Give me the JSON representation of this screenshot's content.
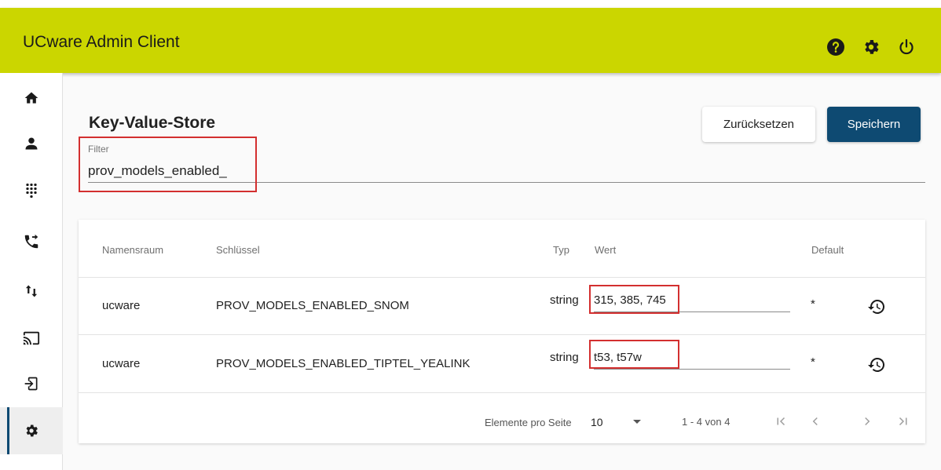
{
  "app": {
    "title": "UCware Admin Client"
  },
  "topbar": {
    "icons": [
      "help-icon",
      "gear-icon",
      "power-icon"
    ]
  },
  "sidebar": {
    "items": [
      {
        "icon": "home-icon"
      },
      {
        "icon": "person-icon"
      },
      {
        "icon": "dialpad-icon"
      },
      {
        "icon": "call-forward-icon"
      },
      {
        "icon": "sort-arrows-icon"
      },
      {
        "icon": "cast-icon"
      },
      {
        "icon": "login-icon"
      },
      {
        "icon": "gear-icon",
        "active": true
      }
    ]
  },
  "page": {
    "title": "Key-Value-Store",
    "reset_label": "Zurücksetzen",
    "save_label": "Speichern"
  },
  "filter": {
    "label": "Filter",
    "value": "prov_models_enabled_"
  },
  "table": {
    "columns": {
      "namespace": "Namensraum",
      "key": "Schlüssel",
      "type": "Typ",
      "value": "Wert",
      "default": "Default"
    },
    "rows": [
      {
        "namespace": "ucware",
        "key": "PROV_MODELS_ENABLED_SNOM",
        "type": "string",
        "value": "315, 385, 745",
        "default": "*"
      },
      {
        "namespace": "ucware",
        "key": "PROV_MODELS_ENABLED_TIPTEL_YEALINK",
        "type": "string",
        "value": "t53, t57w",
        "default": "*"
      }
    ]
  },
  "paginator": {
    "items_per_page_label": "Elemente pro Seite",
    "page_size": "10",
    "range": "1 - 4 von 4"
  },
  "colors": {
    "topbar": "#cbd600",
    "primary": "#0e4a72",
    "highlight": "#d32f2f"
  }
}
